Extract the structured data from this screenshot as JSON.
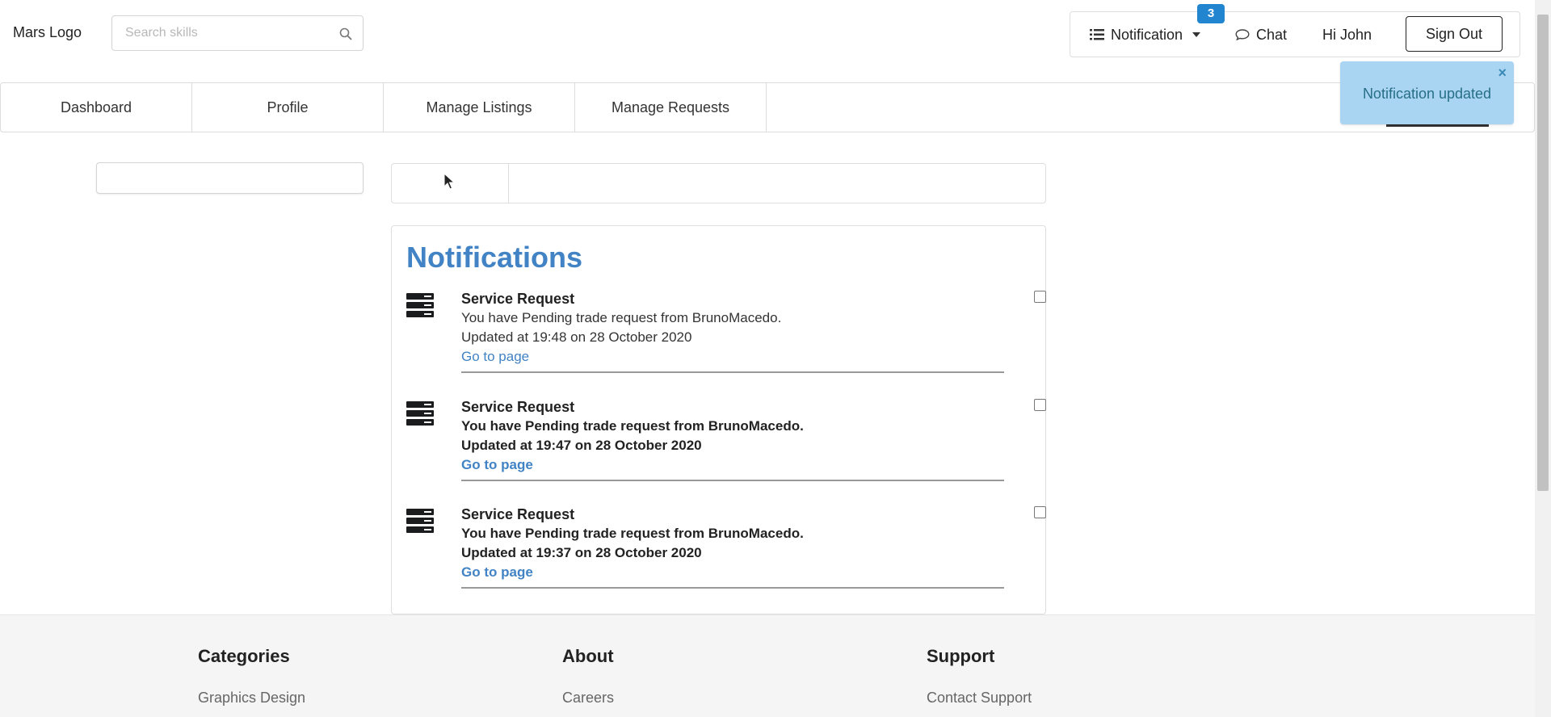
{
  "header": {
    "logo": "Mars Logo",
    "search_placeholder": "Search skills",
    "notification_label": "Notification",
    "notification_count": "3",
    "chat_label": "Chat",
    "greeting": "Hi John",
    "signout_label": "Sign Out"
  },
  "tabs": [
    "Dashboard",
    "Profile",
    "Manage Listings",
    "Manage Requests"
  ],
  "toast": {
    "message": "Notification updated",
    "close": "×"
  },
  "notifications": {
    "title": "Notifications",
    "items": [
      {
        "title": "Service Request",
        "message": "You have Pending trade request from BrunoMacedo.",
        "updated": "Updated at 19:48 on 28 October 2020",
        "link": "Go to page",
        "checked": false,
        "unread": false
      },
      {
        "title": "Service Request",
        "message": "You have Pending trade request from BrunoMacedo.",
        "updated": "Updated at 19:47 on 28 October 2020",
        "link": "Go to page",
        "checked": false,
        "unread": true
      },
      {
        "title": "Service Request",
        "message": "You have Pending trade request from BrunoMacedo.",
        "updated": "Updated at 19:37 on 28 October 2020",
        "link": "Go to page",
        "checked": false,
        "unread": true
      }
    ]
  },
  "footer": {
    "columns": [
      {
        "heading": "Categories",
        "link": "Graphics Design"
      },
      {
        "heading": "About",
        "link": "Careers"
      },
      {
        "heading": "Support",
        "link": "Contact Support"
      }
    ]
  },
  "colors": {
    "accent": "#4183c4",
    "badge": "#2185d0",
    "toast_bg": "#a9d5f2",
    "toast_text": "#276f86"
  }
}
